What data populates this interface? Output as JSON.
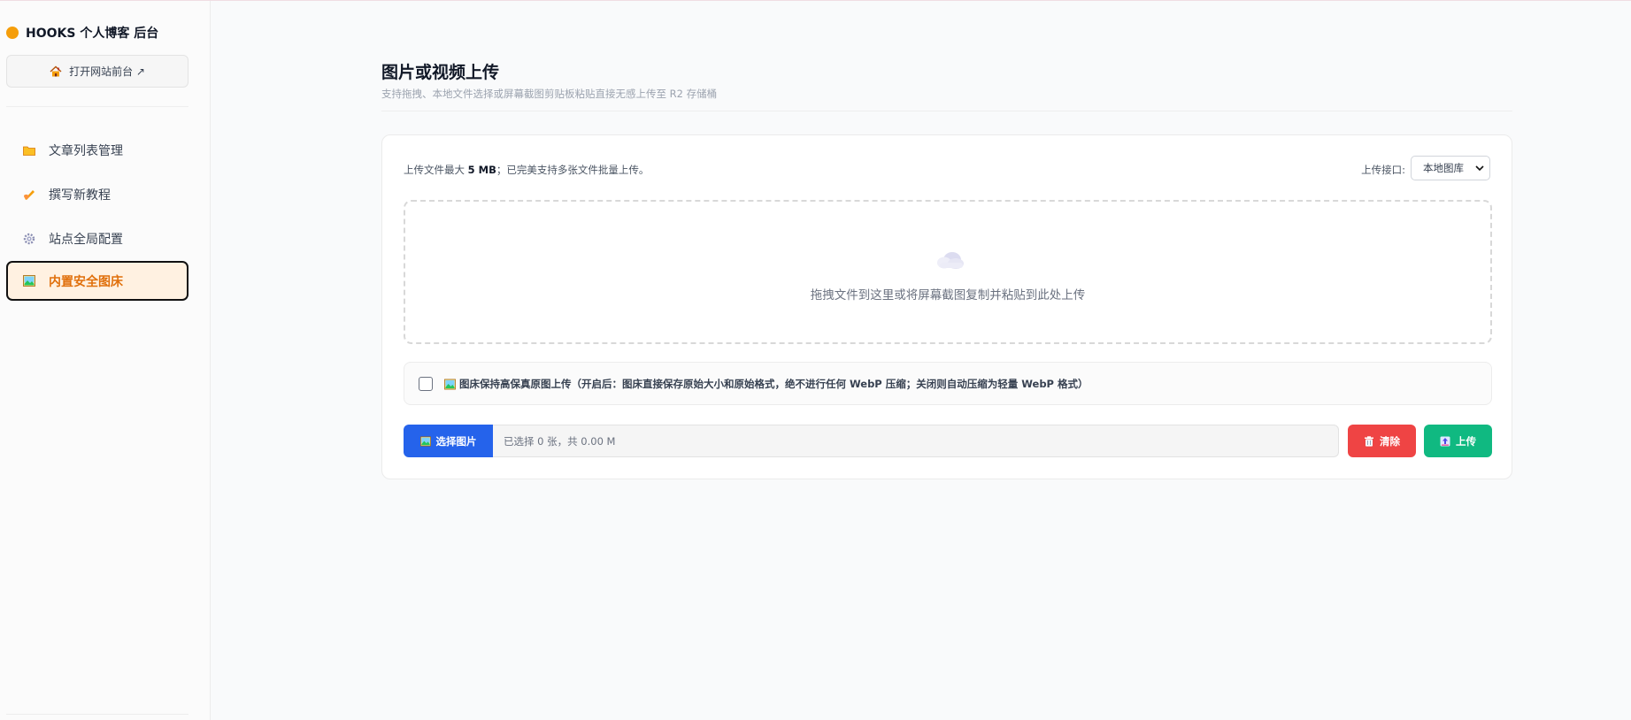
{
  "sidebar": {
    "brand_title": "HOOKS 个人博客 后台",
    "front_button": "打开网站前台 ↗",
    "front_icon": "house-icon",
    "items": [
      {
        "label": "文章列表管理",
        "icon": "folder-icon",
        "active": false
      },
      {
        "label": "撰写新教程",
        "icon": "writing-hand-icon",
        "active": false
      },
      {
        "label": "站点全局配置",
        "icon": "gear-icon",
        "active": false
      },
      {
        "label": "内置安全图床",
        "icon": "picture-icon",
        "active": true
      }
    ]
  },
  "main": {
    "title": "图片或视频上传",
    "subtitle": "支持拖拽、本地文件选择或屏幕截图剪贴板粘贴直接无感上传至 R2 存储桶",
    "limit_prefix": "上传文件最大 ",
    "limit_value": "5 MB",
    "limit_suffix": "；已完美支持多张文件批量上传。",
    "interface_label": "上传接口:",
    "interface_value": "本地图库",
    "drop_text": "拖拽文件到这里或将屏幕截图复制并粘贴到此处上传",
    "option_label": "图床保持高保真原图上传（开启后：图床直接保存原始大小和原始格式，绝不进行任何 WebP 压缩；关闭则自动压缩为轻量 WebP 格式）",
    "option_checked": false,
    "choose_label": "选择图片",
    "file_status": "已选择 0 张，共 0.00 M",
    "clear_label": "清除",
    "upload_label": "上传"
  },
  "colors": {
    "accent_orange": "#f59e0b",
    "active_text": "#e0700c",
    "active_bg": "#fff1e1",
    "primary_blue": "#2563eb",
    "danger_red": "#ef4444",
    "success_green": "#10b981"
  }
}
